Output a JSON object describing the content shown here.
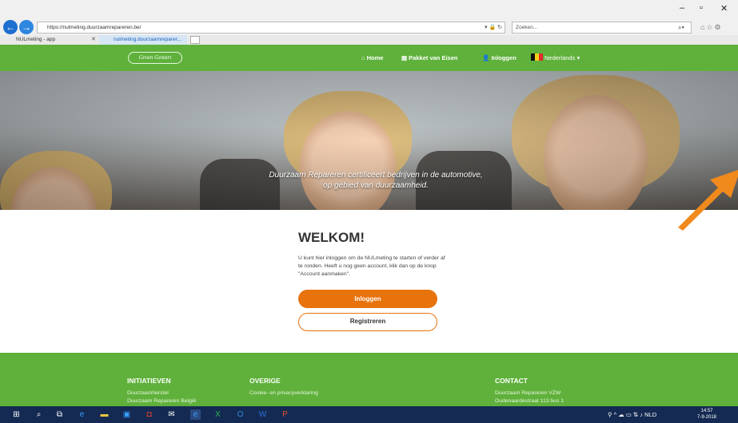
{
  "browser": {
    "url": "https://nulmeting.duurzaamrepareren.be/",
    "search_placeholder": "Zoeken...",
    "tabs": [
      {
        "label": "NULmeting - app"
      },
      {
        "label": "nulmeting.duurzaamreparer..."
      }
    ]
  },
  "site": {
    "logo_text": "Groen Gestart",
    "nav": {
      "home": "Home",
      "pakket": "Pakket van Eisen",
      "login": "Inloggen",
      "language": "Nederlands ▾"
    },
    "hero": {
      "caption_line1": "Duurzaam Repareren certificeert bedrijven in de automotive,",
      "caption_line2": "op gebied van duurzaamheid."
    },
    "welcome": {
      "title": "WELKOM!",
      "text": "U kunt hier inloggen om de NULmeting te starten of verder af te ronden. Heeft u nog geen account, klik dan op de knop \"Account aanmaken\".",
      "login_button": "Inloggen",
      "register_button": "Registreren"
    },
    "footer": {
      "col1": {
        "title": "INITIATIEVEN",
        "items": [
          "Duurzaamherstel",
          "Duurzaam Repareren België"
        ]
      },
      "col2": {
        "title": "OVERIGE",
        "items": [
          "Cookie- en privacyverklaring"
        ]
      },
      "col3": {
        "title": "CONTACT",
        "items": [
          "Duurzaam Repareren VZW",
          "Oudenaardestraat 113 bus 1"
        ]
      }
    }
  },
  "taskbar": {
    "language": "NLD",
    "time": "14:57",
    "date": "7-9-2018"
  },
  "colors": {
    "green": "#5fb13b",
    "orange": "#e8720c",
    "frame_blue": "#3a6fc4"
  }
}
